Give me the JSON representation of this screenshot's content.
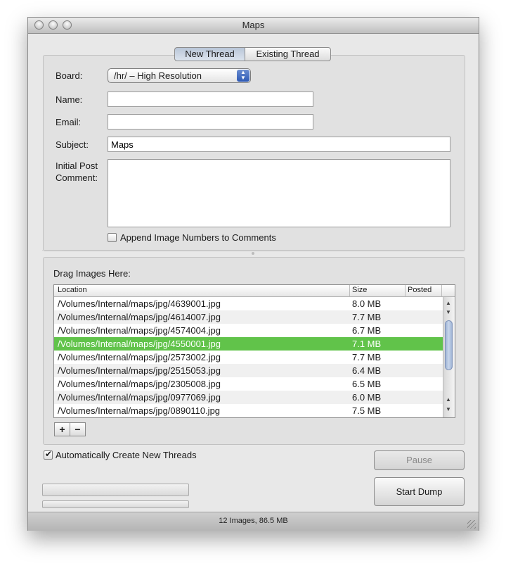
{
  "window": {
    "title": "Maps"
  },
  "tabs": [
    {
      "label": "New Thread",
      "selected": true
    },
    {
      "label": "Existing Thread",
      "selected": false
    }
  ],
  "form": {
    "board_label": "Board:",
    "board_value": "/hr/ – High Resolution",
    "name_label": "Name:",
    "name_value": "",
    "email_label": "Email:",
    "email_value": "",
    "subject_label": "Subject:",
    "subject_value": "Maps",
    "comment_label_line1": "Initial Post",
    "comment_label_line2": "Comment:",
    "comment_value": "",
    "append_checkbox_label": "Append Image Numbers to Comments",
    "append_checked": false
  },
  "images": {
    "drag_label": "Drag Images Here:",
    "columns": [
      "Location",
      "Size",
      "Posted"
    ],
    "rows": [
      {
        "location": "/Volumes/Internal/maps/jpg/4639001.jpg",
        "size": "8.0 MB",
        "posted": ""
      },
      {
        "location": "/Volumes/Internal/maps/jpg/4614007.jpg",
        "size": "7.7 MB",
        "posted": ""
      },
      {
        "location": "/Volumes/Internal/maps/jpg/4574004.jpg",
        "size": "6.7 MB",
        "posted": ""
      },
      {
        "location": "/Volumes/Internal/maps/jpg/4550001.jpg",
        "size": "7.1 MB",
        "posted": "",
        "selected": true
      },
      {
        "location": "/Volumes/Internal/maps/jpg/2573002.jpg",
        "size": "7.7 MB",
        "posted": ""
      },
      {
        "location": "/Volumes/Internal/maps/jpg/2515053.jpg",
        "size": "6.4 MB",
        "posted": ""
      },
      {
        "location": "/Volumes/Internal/maps/jpg/2305008.jpg",
        "size": "6.5 MB",
        "posted": ""
      },
      {
        "location": "/Volumes/Internal/maps/jpg/0977069.jpg",
        "size": "6.0 MB",
        "posted": ""
      },
      {
        "location": "/Volumes/Internal/maps/jpg/0890110.jpg",
        "size": "7.5 MB",
        "posted": ""
      }
    ],
    "add_label": "+",
    "remove_label": "−"
  },
  "controls": {
    "auto_create_label": "Automatically Create New Threads",
    "auto_create_checked": true,
    "pause_label": "Pause",
    "start_label": "Start Dump",
    "progress_primary": 0,
    "progress_secondary": 0
  },
  "status": {
    "text": "12 Images, 86.5 MB"
  },
  "colors": {
    "selection": "#61c34a",
    "tab_selected": "#c9d4e3"
  },
  "icons": {
    "scroll_up": "▲",
    "scroll_down": "▼",
    "popup_arrows": "▲▼",
    "checkmark": "✔"
  }
}
